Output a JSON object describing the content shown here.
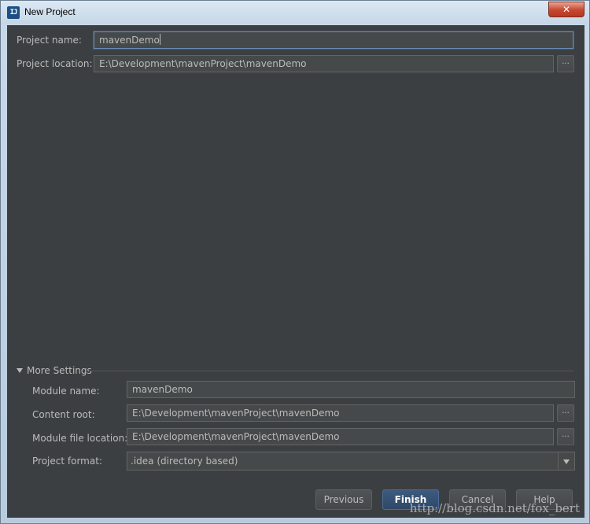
{
  "window": {
    "title": "New Project",
    "close_symbol": "✕",
    "app_icon": "intellij-icon"
  },
  "project": {
    "name_label": "Project name:",
    "name_value": "mavenDemo",
    "location_label": "Project location:",
    "location_value": "E:\\Development\\mavenProject\\mavenDemo",
    "browse_symbol": "..."
  },
  "more_settings": {
    "header": "More Settings",
    "module_name_label": "Module name:",
    "module_name_value": "mavenDemo",
    "content_root_label": "Content root:",
    "content_root_value": "E:\\Development\\mavenProject\\mavenDemo",
    "module_file_label": "Module file location:",
    "module_file_value": "E:\\Development\\mavenProject\\mavenDemo",
    "format_label": "Project format:",
    "format_value": ".idea (directory based)",
    "browse_symbol": "..."
  },
  "buttons": {
    "previous": "Previous",
    "finish": "Finish",
    "cancel": "Cancel",
    "help": "Help"
  },
  "watermark": "http://blog.csdn.net/fox_bert",
  "colors": {
    "background": "#3c3f41",
    "field": "#45494a",
    "text": "#bbbbbb",
    "focus": "#6a8bb0",
    "primary_button": "#365880"
  }
}
